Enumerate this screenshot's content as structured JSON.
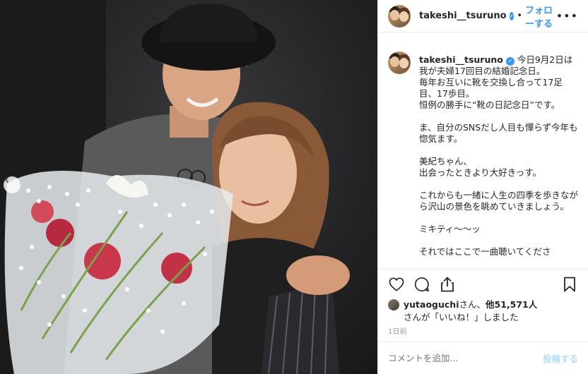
{
  "post": {
    "username": "takeshi__tsuruno",
    "verified_icon": "verified-badge-icon",
    "separator": "•",
    "follow_label": "フォローする",
    "more_icon": "ellipsis-icon",
    "more_label": "•••"
  },
  "caption": {
    "username": "takeshi__tsuruno",
    "text": "今日9月2日は我が夫婦17回目の結婚記念日。\n毎年お互いに靴を交換し合って17足目、17歩目。\n恒例の勝手に“靴の日記念日”です。\n\nま、自分のSNSだし人目も憚らず今年も惚気ます。\n\n美紀ちゃん、\n出会ったときより大好きっす。\n\nこれからも一緒に人生の四季を歩きながら沢山の景色を眺めていきましょう。\n\nミキティ〜〜ッ\n\nそれではここで一曲聴いてくださ"
  },
  "actions": {
    "like_icon": "heart-icon",
    "comment_icon": "comment-icon",
    "share_icon": "share-icon",
    "save_icon": "bookmark-icon"
  },
  "likes": {
    "liker": "yutaoguchi",
    "suffix1": "さん、",
    "others": "他51,571人",
    "line2": "さんが「いいね！」しました"
  },
  "time_ago": "1日前",
  "comment": {
    "placeholder": "コメントを追加...",
    "post_label": "投稿する"
  },
  "photo": {
    "prev_icon": "chevron-left-icon"
  },
  "colors": {
    "accent": "#3897f0",
    "post_disabled": "#b2dffc",
    "muted": "#999999"
  }
}
